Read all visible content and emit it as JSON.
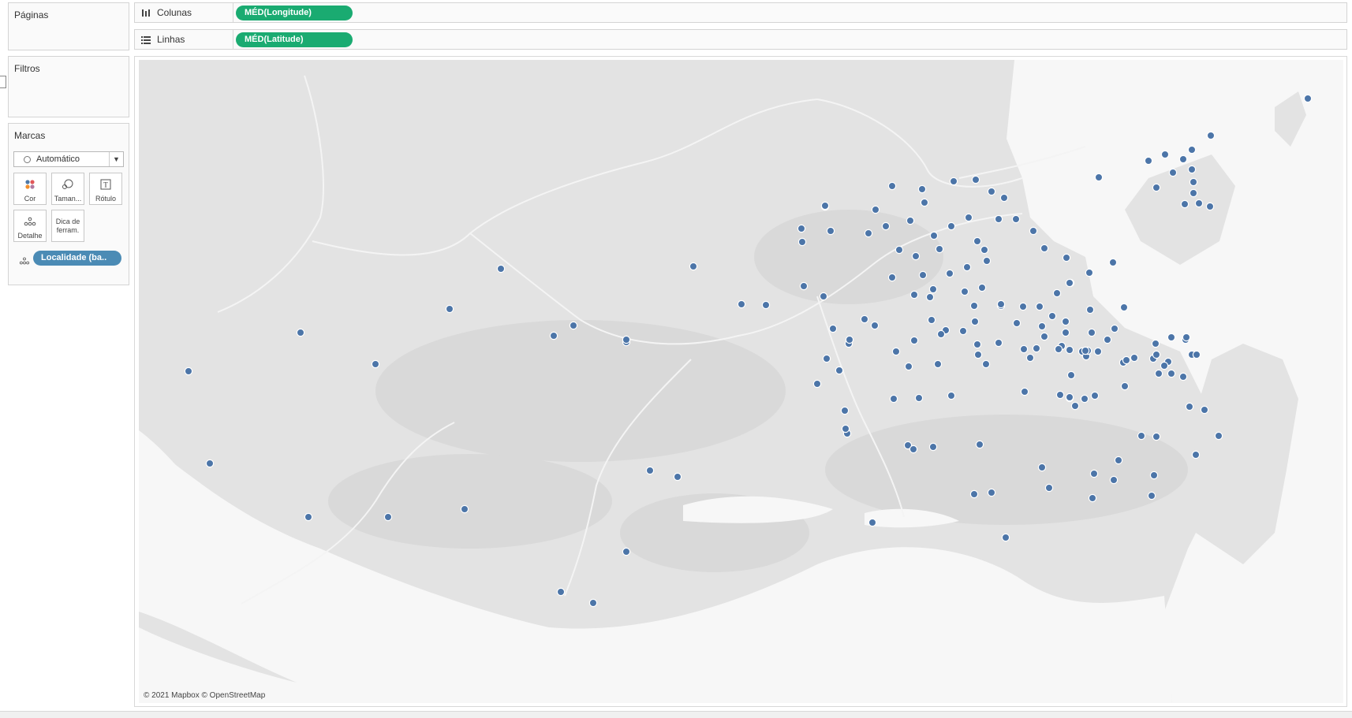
{
  "cards": {
    "pages_title": "Páginas",
    "filters_title": "Filtros",
    "marks_title": "Marcas"
  },
  "marks": {
    "type_value": "Automático",
    "buttons": {
      "color": "Cor",
      "size": "Taman...",
      "label": "Rótulo",
      "detail": "Detalhe",
      "tooltip": "Dica de ferram."
    },
    "detail_pill": "Localidade (ba.."
  },
  "shelves": {
    "columns_label": "Colunas",
    "columns_pill": "MÉD(Longitude)",
    "rows_label": "Linhas",
    "rows_pill": "MÉD(Latitude)"
  },
  "map": {
    "attribution": "© 2021 Mapbox © OpenStreetMap",
    "point_color": "#4c75a8",
    "point_count": 170
  },
  "colors": {
    "pill_green": "#1aab71",
    "pill_blue": "#4b8bb5"
  }
}
